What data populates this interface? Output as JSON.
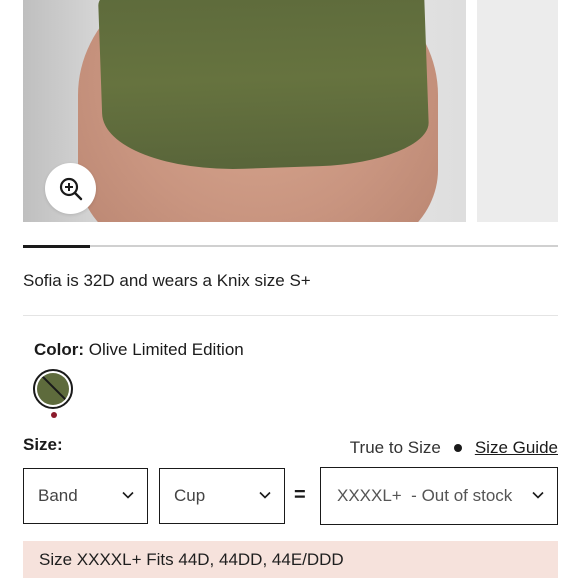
{
  "gallery": {
    "main_image_alt": "",
    "zoom_icon": "zoom-in-icon",
    "progress": 0.125
  },
  "model_note": "Sofia is 32D and wears a Knix size S+",
  "color": {
    "label": "Color:",
    "value": "Olive Limited Edition",
    "swatch_hex": "#5e6b3c",
    "indicator_hex": "#8b1a2b"
  },
  "size": {
    "label": "Size:",
    "fit_text": "True to Size",
    "guide_link": "Size Guide",
    "band_placeholder": "Band",
    "cup_placeholder": "Cup",
    "equals": "=",
    "size_value": "XXXXL+  - Out of stock",
    "fit_note": "Size XXXXL+ Fits 44D, 44DD, 44E/DDD"
  }
}
